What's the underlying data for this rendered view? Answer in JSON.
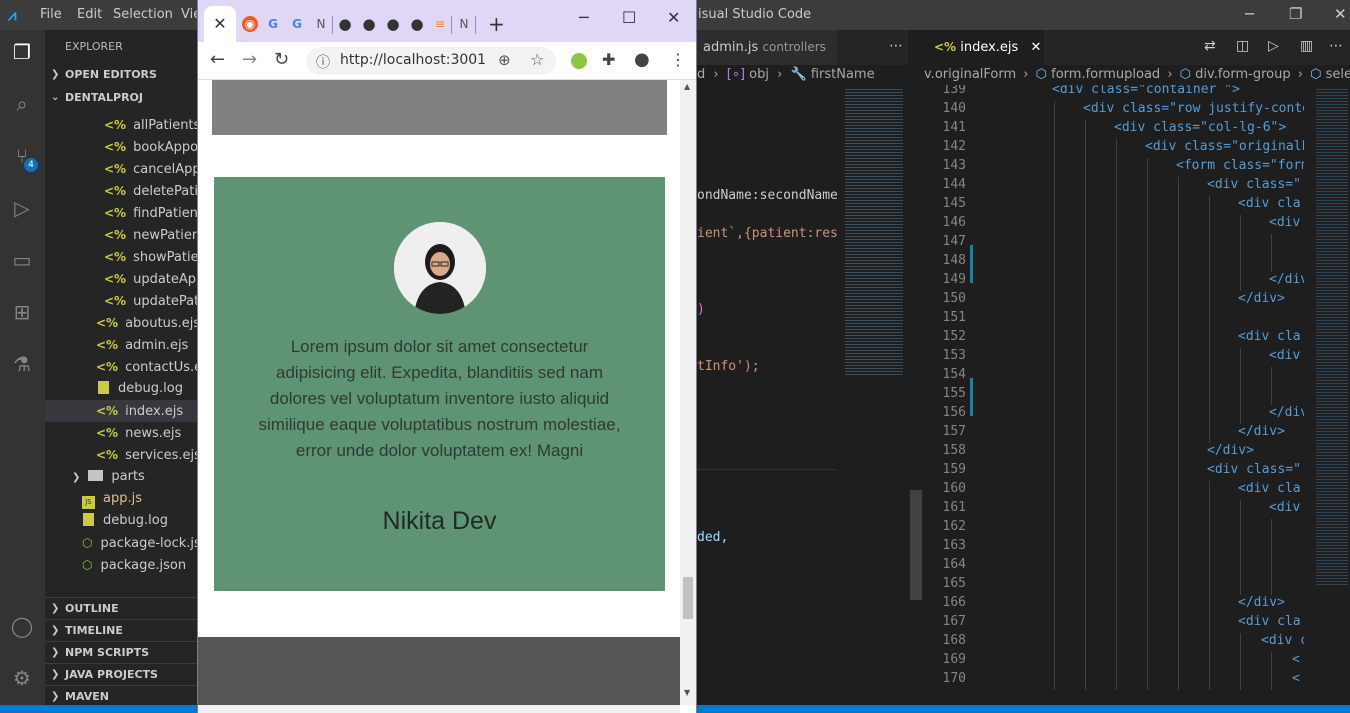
{
  "vscode": {
    "menu": [
      "File",
      "Edit",
      "Selection",
      "Vie"
    ],
    "window_title": "isual Studio Code",
    "explorer_title": "EXPLORER",
    "sections": {
      "open_editors": "OPEN EDITORS",
      "project": "DENTALPROJ",
      "outline": "OUTLINE",
      "timeline": "TIMELINE",
      "npm": "NPM SCRIPTS",
      "java": "JAVA PROJECTS",
      "maven": "MAVEN"
    },
    "scm_badge": "4",
    "files_nested": [
      "allPatients.ejs",
      "bookAppoin",
      "cancelAppoi",
      "deletePatien",
      "findPatient.e",
      "newPatient.e",
      "showPatient.",
      "updateAppo",
      "updatePatien"
    ],
    "files_views": [
      "aboutus.ejs",
      "admin.ejs",
      "contactUs.ejs",
      "debug.log",
      "index.ejs",
      "news.ejs",
      "services.ejs"
    ],
    "folder_parts": "parts",
    "files_root": [
      "app.js",
      "debug.log",
      "package-lock.json",
      "package.json"
    ],
    "left_editor": {
      "tab_name": "admin.js",
      "tab_desc": "controllers",
      "breadcrumb": [
        "d",
        "obj",
        "firstName"
      ],
      "code": [
        "ondName:secondName",
        "ient`,{patient:res",
        ")",
        "tInfo');",
        "ded,"
      ]
    },
    "right_editor": {
      "tab_name": "index.ejs",
      "breadcrumb": [
        "v.originalForm",
        "form.formupload",
        "div.form-group",
        "select#t"
      ],
      "line_numbers": [
        "139",
        "140",
        "141",
        "142",
        "143",
        "144",
        "145",
        "146",
        "147",
        "148",
        "149",
        "150",
        "151",
        "152",
        "153",
        "154",
        "155",
        "156",
        "157",
        "158",
        "159",
        "160",
        "161",
        "162",
        "163",
        "164",
        "165",
        "166",
        "167",
        "168",
        "169",
        "170"
      ],
      "code": [
        "<div class=\"container \">",
        "<div class=\"row justify-conte",
        "<div class=\"col-lg-6\">",
        "<div class=\"originalF",
        "<form class=\"form",
        "<div class=\"",
        "<div cla",
        "<div",
        "",
        "",
        "</div",
        "</div>",
        "",
        "<div cla",
        "<div",
        "",
        "",
        "</div",
        "</div>",
        "</div>",
        "<div class=\"",
        "<div cla",
        "<div",
        "",
        "",
        "",
        "",
        "</div>",
        "<div cla",
        "<div c",
        "<",
        "<"
      ]
    }
  },
  "chrome": {
    "url": "http://localhost:3001",
    "tab_close": "✕",
    "new_tab": "+"
  },
  "testimonial": {
    "quote": "Lorem ipsum dolor sit amet consectetur adipisicing elit. Expedita, blanditiis sed nam dolores vel voluptatum inventore iusto aliquid similique eaque voluptatibus nostrum molestiae, error unde dolor voluptatem ex! Magni",
    "name": "Nikita Dev"
  }
}
